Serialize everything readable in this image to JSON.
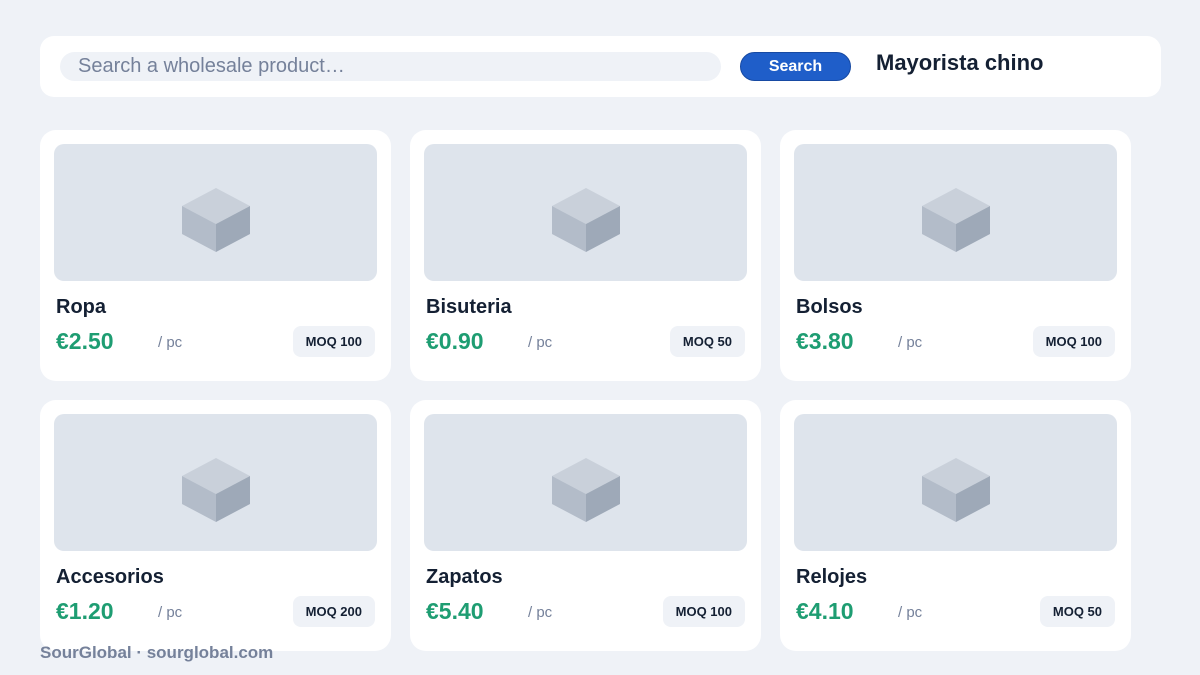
{
  "search": {
    "placeholder": "Search a wholesale product…",
    "button_label": "Search"
  },
  "header": {
    "title": "Mayorista chino"
  },
  "products": [
    {
      "name": "Ropa",
      "price": "€2.50",
      "unit": "/ pc",
      "moq": "MOQ 100"
    },
    {
      "name": "Bisuteria",
      "price": "€0.90",
      "unit": "/ pc",
      "moq": "MOQ 50"
    },
    {
      "name": "Bolsos",
      "price": "€3.80",
      "unit": "/ pc",
      "moq": "MOQ 100"
    },
    {
      "name": "Accesorios",
      "price": "€1.20",
      "unit": "/ pc",
      "moq": "MOQ 200"
    },
    {
      "name": "Zapatos",
      "price": "€5.40",
      "unit": "/ pc",
      "moq": "MOQ 100"
    },
    {
      "name": "Relojes",
      "price": "€4.10",
      "unit": "/ pc",
      "moq": "MOQ 50"
    }
  ],
  "footer": {
    "text": "SourGlobal · sourglobal.com"
  },
  "colors": {
    "accent": "#1f5ec9",
    "price": "#1e9d72",
    "background": "#eff2f7",
    "thumb": "#dee4ec"
  },
  "icons": {
    "product_placeholder": "box-icon"
  }
}
